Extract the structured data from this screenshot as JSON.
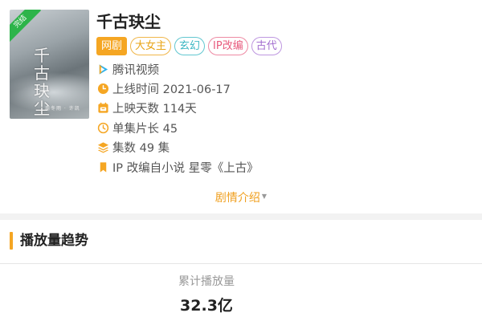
{
  "poster": {
    "badge": "完结",
    "title_art": "千古玦尘",
    "subtitle_art": "周冬雨 · 许凯"
  },
  "show": {
    "title": "千古玦尘",
    "tags": [
      {
        "label": "网剧",
        "style": "primary"
      },
      {
        "label": "大女主",
        "style": "c1"
      },
      {
        "label": "玄幻",
        "style": "c2"
      },
      {
        "label": "IP改编",
        "style": "c3"
      },
      {
        "label": "古代",
        "style": "c4"
      }
    ],
    "platform": "腾讯视频",
    "release": "上线时间 2021-06-17",
    "days": "上映天数 114天",
    "episode_length": "单集片长 45",
    "episodes": "集数 49 集",
    "ip_source": "IP 改编自小说 星零《上古》"
  },
  "intro": {
    "label": "剧情介绍"
  },
  "section": {
    "title": "播放量趋势"
  },
  "stats": {
    "label": "累计播放量",
    "value": "32.3亿"
  },
  "colors": {
    "accent": "#f5a623",
    "tag_orange": "#e8a417",
    "tag_teal": "#3fb8c4",
    "tag_pink": "#e85a7d",
    "tag_purple": "#a36fd0",
    "badge_green": "#2db44a"
  },
  "icons": {
    "platform": "tencent-video-logo-icon",
    "release": "clock-icon",
    "days": "calendar-icon",
    "episode_length": "timer-icon",
    "episodes": "layers-icon",
    "ip_source": "bookmark-icon",
    "intro_caret": "caret-down-icon"
  }
}
